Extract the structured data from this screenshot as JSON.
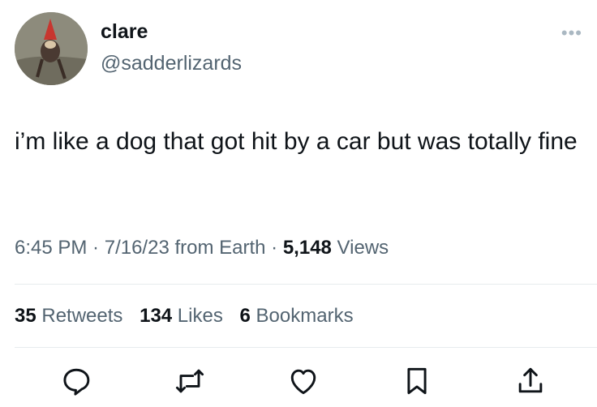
{
  "author": {
    "display_name": "clare",
    "handle": "@sadderlizards"
  },
  "tweet": {
    "text": "i’m like a dog that got hit by a car but was totally fine"
  },
  "meta": {
    "time": "6:45 PM",
    "sep1": " · ",
    "date": "7/16/23",
    "location": " from Earth",
    "sep2": " · ",
    "views_count": "5,148",
    "views_label": " Views"
  },
  "stats": {
    "retweets_count": "35",
    "retweets_label": " Retweets",
    "likes_count": "134",
    "likes_label": " Likes",
    "bookmarks_count": "6",
    "bookmarks_label": " Bookmarks"
  },
  "icons": {
    "more": "more-dots-icon",
    "reply": "reply-icon",
    "retweet": "retweet-icon",
    "like": "heart-icon",
    "bookmark": "bookmark-icon",
    "share": "share-icon"
  },
  "colors": {
    "text": "#0f1419",
    "secondary": "#536471",
    "divider": "#e7ebee"
  }
}
